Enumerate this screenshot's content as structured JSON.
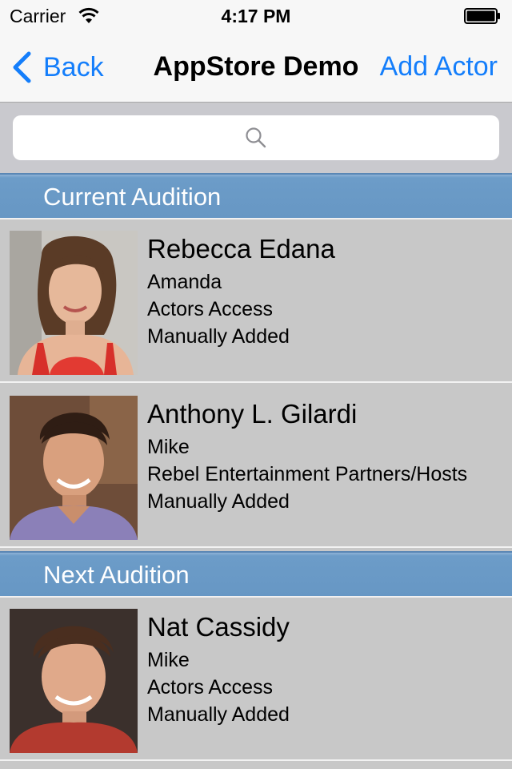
{
  "status_bar": {
    "carrier": "Carrier",
    "time": "4:17 PM"
  },
  "nav": {
    "back_label": "Back",
    "title": "AppStore Demo",
    "add_label": "Add Actor"
  },
  "search": {
    "placeholder": ""
  },
  "sections": [
    {
      "title": "Current Audition",
      "actors": [
        {
          "name": "Rebecca Edana",
          "role": "Amanda",
          "agency": "Actors Access",
          "source": "Manually Added"
        },
        {
          "name": "Anthony L. Gilardi",
          "role": "Mike",
          "agency": "Rebel Entertainment Partners/Hosts",
          "source": "Manually Added"
        }
      ]
    },
    {
      "title": "Next Audition",
      "actors": [
        {
          "name": "Nat Cassidy",
          "role": "Mike",
          "agency": "Actors Access",
          "source": "Manually Added"
        }
      ]
    }
  ],
  "colors": {
    "tint": "#147efb",
    "section_header": "#6797c4",
    "row_background": "#c8c8c8"
  }
}
